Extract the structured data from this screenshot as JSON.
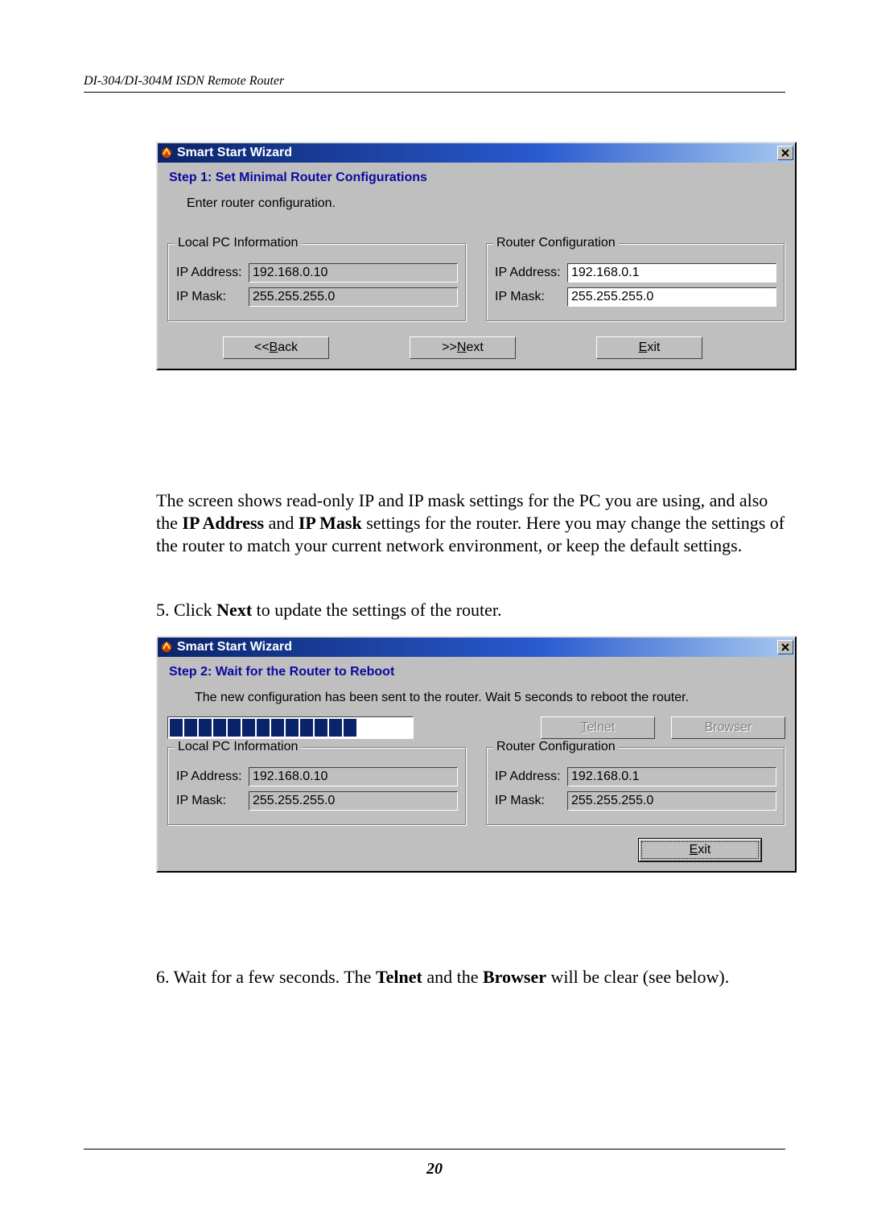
{
  "header": {
    "text": "DI-304/DI-304M ISDN Remote Router"
  },
  "page_number": "20",
  "dialog1": {
    "title": "Smart Start Wizard",
    "step": "Step 1: Set Minimal Router Configurations",
    "message": "Enter router configuration.",
    "local": {
      "legend": "Local PC Information",
      "ip_label": "IP Address:",
      "ip_value": "192.168.0.10",
      "mask_label": "IP Mask:",
      "mask_value": "255.255.255.0"
    },
    "router": {
      "legend": "Router Configuration",
      "ip_label": "IP Address:",
      "ip_value": "192.168.0.1",
      "mask_label": "IP Mask:",
      "mask_value": "255.255.255.0"
    },
    "buttons": {
      "back_prefix": "<<",
      "back_letter": "B",
      "back_rest": "ack",
      "next_prefix": ">>",
      "next_letter": "N",
      "next_rest": "ext",
      "exit_letter": "E",
      "exit_rest": "xit"
    }
  },
  "para1": {
    "t1": "The screen shows read-only IP and IP mask settings for the PC you are using, and also the ",
    "b1": "IP Address",
    "t2": " and ",
    "b2": "IP Mask",
    "t3": " settings for the router. Here you may change the settings of the router to match your current network environment, or keep the default settings."
  },
  "step5": {
    "num": "5. Click ",
    "bold": "Next",
    "rest": " to update the settings of the router."
  },
  "dialog2": {
    "title": "Smart Start Wizard",
    "step": "Step 2: Wait for the Router to Reboot",
    "message": "The new configuration has been sent to the router. Wait 5 seconds to reboot the router.",
    "progress_chunks": 13,
    "telnet_letter": "T",
    "telnet_rest": "elnet",
    "browser_label": "Browser",
    "local": {
      "legend": "Local PC Information",
      "ip_label": "IP Address:",
      "ip_value": "192.168.0.10",
      "mask_label": "IP Mask:",
      "mask_value": "255.255.255.0"
    },
    "router": {
      "legend": "Router Configuration",
      "ip_label": "IP Address:",
      "ip_value": "192.168.0.1",
      "mask_label": "IP Mask:",
      "mask_value": "255.255.255.0"
    },
    "exit_letter": "E",
    "exit_rest": "xit"
  },
  "step6": {
    "num": "6. Wait for a few seconds. The ",
    "b1": "Telnet",
    "mid": " and the ",
    "b2": "Browser",
    "rest": " will be clear (see below)."
  }
}
